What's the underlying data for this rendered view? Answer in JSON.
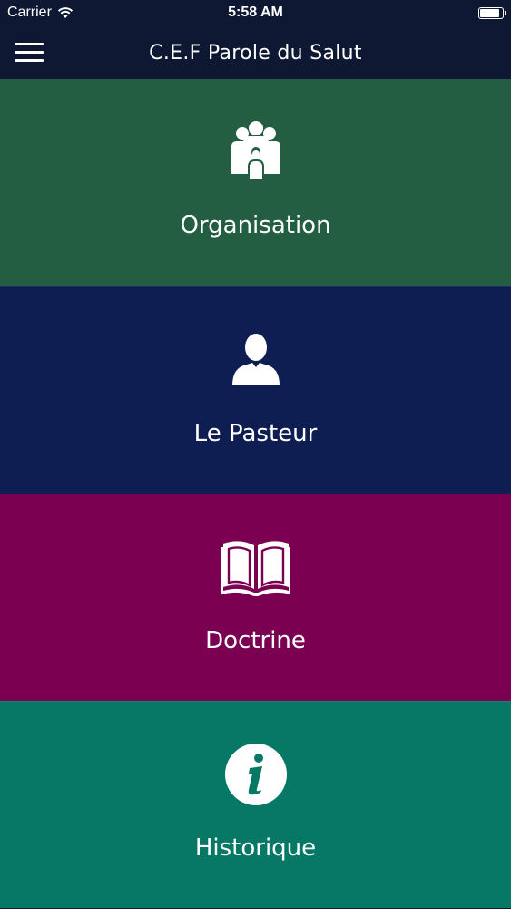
{
  "status_bar": {
    "carrier": "Carrier",
    "time": "5:58 AM",
    "battery_level": 0.95
  },
  "nav": {
    "title": "C.E.F Parole du Salut"
  },
  "tiles": [
    {
      "label": "Organisation",
      "icon": "group-icon",
      "color": "#235e42"
    },
    {
      "label": "Le Pasteur",
      "icon": "person-icon",
      "color": "#0e1d52"
    },
    {
      "label": "Doctrine",
      "icon": "book-icon",
      "color": "#7b0052"
    },
    {
      "label": "Historique",
      "icon": "info-icon",
      "color": "#087866"
    }
  ]
}
